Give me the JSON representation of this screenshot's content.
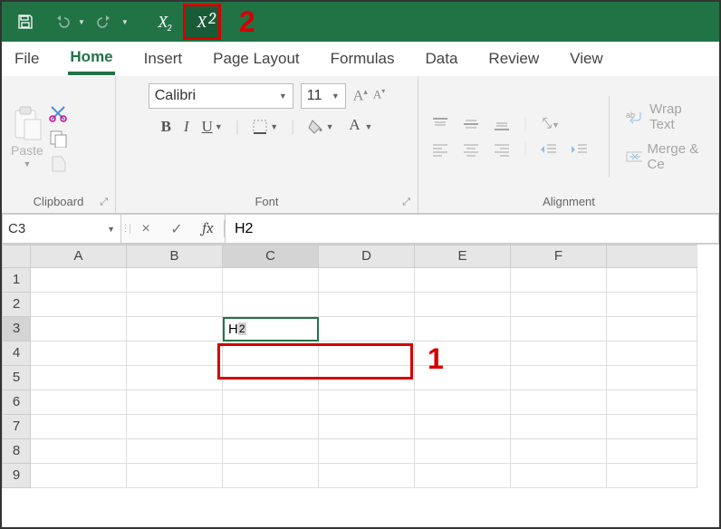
{
  "qat": {
    "save": "save-icon",
    "undo": "undo-icon",
    "redo": "redo-icon",
    "subscript": {
      "base": "X",
      "sub": "2"
    },
    "superscript": {
      "base": "X",
      "sup": "2"
    }
  },
  "annotations": {
    "a2": "2",
    "a1": "1"
  },
  "tabs": [
    "File",
    "Home",
    "Insert",
    "Page Layout",
    "Formulas",
    "Data",
    "Review",
    "View"
  ],
  "active_tab": "Home",
  "ribbon": {
    "clipboard": {
      "paste": "Paste",
      "label": "Clipboard"
    },
    "font": {
      "name": "Calibri",
      "size": "11",
      "bold": "B",
      "italic": "I",
      "underline": "U",
      "border": "border-icon",
      "fill": "fill-icon",
      "color": "font-color-icon",
      "color_swatch": "#d60000",
      "label": "Font"
    },
    "alignment": {
      "wrap": "Wrap Text",
      "merge": "Merge & Ce",
      "label": "Alignment"
    }
  },
  "formula_bar": {
    "namebox": "C3",
    "cancel": "×",
    "enter": "✓",
    "fx": "fx",
    "value": "H2"
  },
  "grid": {
    "columns": [
      "A",
      "B",
      "C",
      "D",
      "E",
      "F"
    ],
    "rows": [
      "1",
      "2",
      "3",
      "4",
      "5",
      "6",
      "7",
      "8",
      "9"
    ],
    "active_col": "C",
    "active_row": "3",
    "cell_value_base": "H",
    "cell_value_selected": "2"
  },
  "chart_data": null
}
